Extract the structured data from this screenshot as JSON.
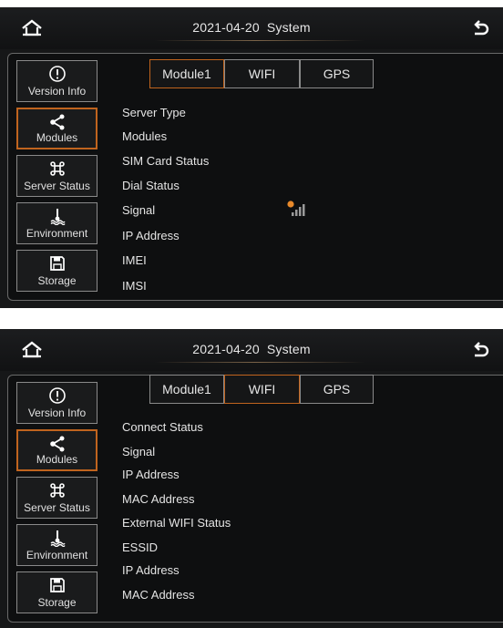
{
  "screens": [
    {
      "header": {
        "date": "2021-04-20",
        "title": "System"
      },
      "sidebar": [
        {
          "label": "Version Info",
          "icon": "info-icon"
        },
        {
          "label": "Modules",
          "icon": "share-icon",
          "active": true
        },
        {
          "label": "Server Status",
          "icon": "command-icon"
        },
        {
          "label": "Environment",
          "icon": "thermometer-icon"
        },
        {
          "label": "Storage",
          "icon": "floppy-disk-icon"
        }
      ],
      "tabs": [
        {
          "label": "Module1",
          "active": true
        },
        {
          "label": "WIFI"
        },
        {
          "label": "GPS"
        }
      ],
      "rows": [
        "Server Type",
        "Modules",
        "SIM Card Status",
        "Dial Status",
        "Signal",
        "IP Address",
        "IMEI",
        "IMSI"
      ],
      "signal_indicator": {
        "icon": "cellular-signal-icon",
        "status_dot_color": "#e8892b"
      }
    },
    {
      "header": {
        "date": "2021-04-20",
        "title": "System"
      },
      "sidebar": [
        {
          "label": "Version Info",
          "icon": "info-icon"
        },
        {
          "label": "Modules",
          "icon": "share-icon",
          "active": true
        },
        {
          "label": "Server Status",
          "icon": "command-icon"
        },
        {
          "label": "Environment",
          "icon": "thermometer-icon"
        },
        {
          "label": "Storage",
          "icon": "floppy-disk-icon"
        }
      ],
      "tabs": [
        {
          "label": "Module1"
        },
        {
          "label": "WIFI",
          "active": true
        },
        {
          "label": "GPS"
        }
      ],
      "rows": [
        "Connect Status",
        "Signal",
        "IP Address",
        "MAC Address",
        "External WIFI Status",
        "ESSID",
        "IP Address",
        "MAC Address"
      ]
    }
  ],
  "colors": {
    "accent": "#c0641e",
    "background": "#161718",
    "text": "#e4e4e4"
  }
}
